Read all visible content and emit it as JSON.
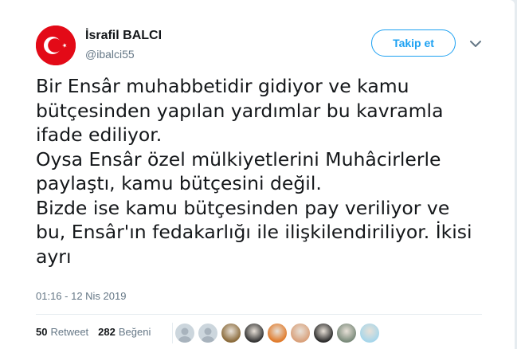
{
  "tweet": {
    "author_name": "İsrafil BALCI",
    "author_handle": "@ibalci55",
    "follow_label": "Takip et",
    "text_lines": [
      "Bir Ensâr muhabbetidir gidiyor ve kamu",
      "bütçesinden yapılan yardımlar bu kavramla",
      "ifade ediliyor.",
      "Oysa Ensâr özel mülkiyetlerini Muhâcirlerle",
      "paylaştı, kamu bütçesini değil.",
      "Bizde ise kamu bütçesinden pay veriliyor ve",
      "bu, Ensâr'ın fedakarlığı ile ilişkilendiriliyor. İkisi",
      "ayrı"
    ],
    "timestamp": "01:16 - 12 Nis 2019",
    "retweet_count": "50",
    "retweet_label": "Retweet",
    "like_count": "282",
    "like_label": "Beğeni"
  },
  "colors": {
    "accent": "#1da1f2",
    "text": "#14171a",
    "secondary": "#657786",
    "flag_red": "#e30a17"
  },
  "icons": {
    "avatar": "turkish-flag",
    "menu": "chevron-down-icon"
  },
  "likers": [
    {
      "style": "default",
      "color": "#a8b3bd"
    },
    {
      "style": "default",
      "color": "#a8b3bd"
    },
    {
      "style": "photo",
      "color": "#8a6a3a"
    },
    {
      "style": "photo",
      "color": "#333333"
    },
    {
      "style": "photo",
      "color": "#e07a2a"
    },
    {
      "style": "photo",
      "color": "#d9a07a"
    },
    {
      "style": "photo",
      "color": "#2b2b2b"
    },
    {
      "style": "photo",
      "color": "#7a8a7a"
    },
    {
      "style": "photo",
      "color": "#a6d6ea"
    }
  ]
}
